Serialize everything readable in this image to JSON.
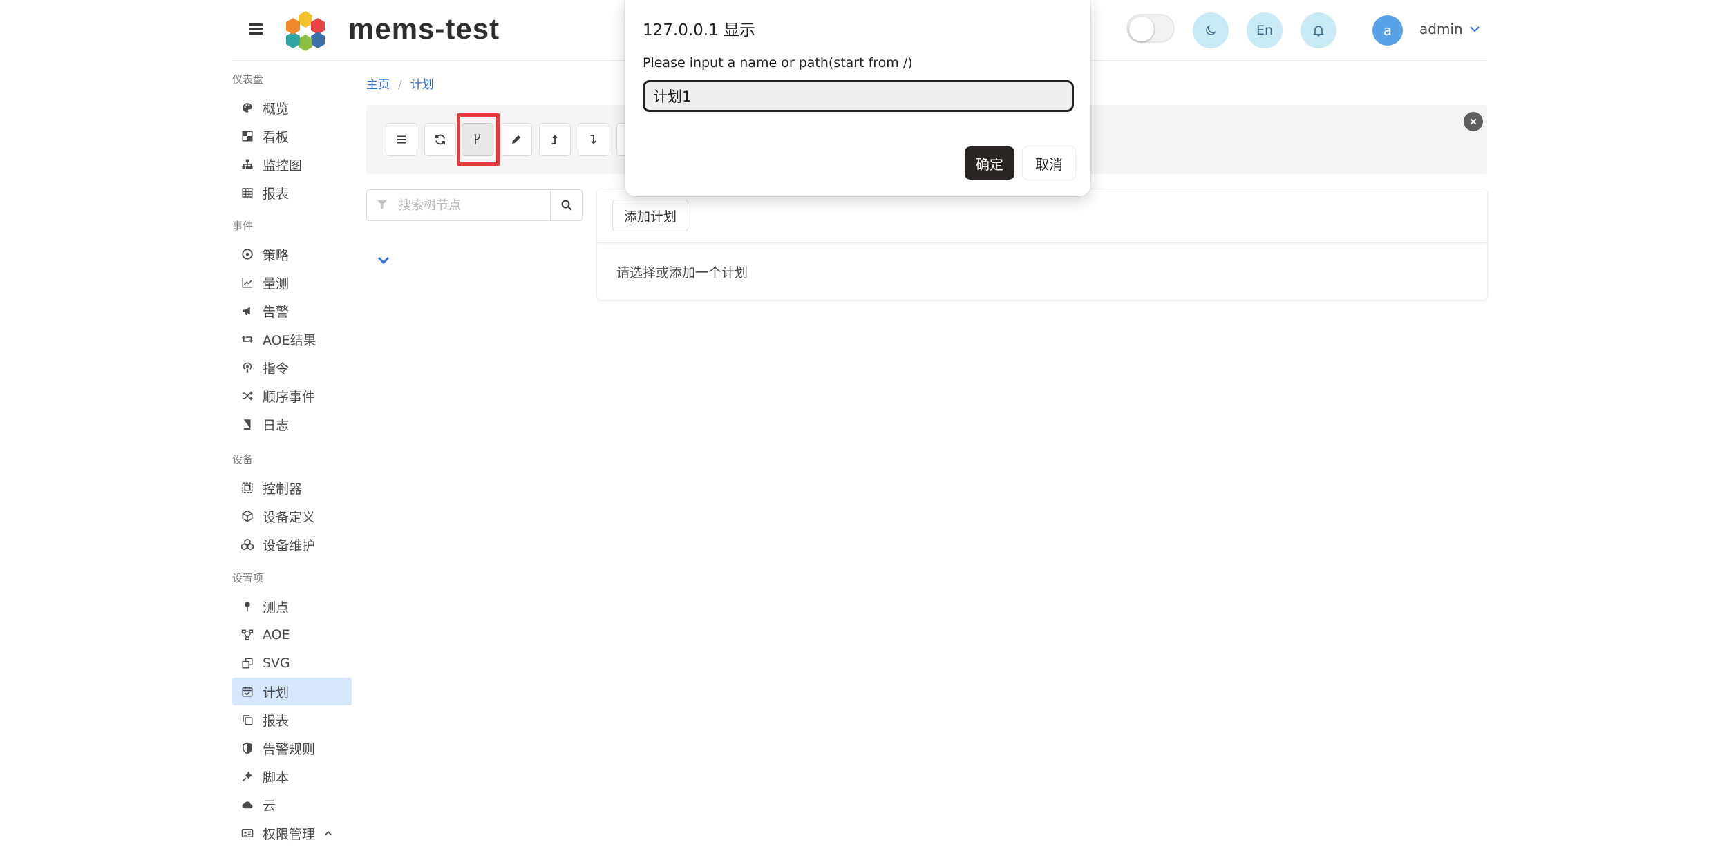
{
  "header": {
    "brand": "mems-test",
    "theme_btn_icon": "moon-icon",
    "lang_label": "En",
    "user_initial": "a",
    "user_name": "admin"
  },
  "sidebar": {
    "sections": [
      {
        "label": "仪表盘",
        "items": [
          {
            "label": "概览",
            "icon": "palette-icon"
          },
          {
            "label": "看板",
            "icon": "board-icon"
          },
          {
            "label": "监控图",
            "icon": "sitemap-icon"
          },
          {
            "label": "报表",
            "icon": "table-icon"
          }
        ]
      },
      {
        "label": "事件",
        "items": [
          {
            "label": "策略",
            "icon": "compass-icon"
          },
          {
            "label": "量测",
            "icon": "chart-line-icon"
          },
          {
            "label": "告警",
            "icon": "bullhorn-icon"
          },
          {
            "label": "AOE结果",
            "icon": "retweet-icon"
          },
          {
            "label": "指令",
            "icon": "podcast-icon"
          },
          {
            "label": "顺序事件",
            "icon": "random-icon"
          },
          {
            "label": "日志",
            "icon": "book-icon"
          }
        ]
      },
      {
        "label": "设备",
        "items": [
          {
            "label": "控制器",
            "icon": "object-group-icon"
          },
          {
            "label": "设备定义",
            "icon": "cube-icon"
          },
          {
            "label": "设备维护",
            "icon": "cubes-icon"
          }
        ]
      },
      {
        "label": "设置项",
        "items": [
          {
            "label": "测点",
            "icon": "thumbtack-icon"
          },
          {
            "label": "AOE",
            "icon": "project-diagram-icon"
          },
          {
            "label": "SVG",
            "icon": "clone-icon"
          },
          {
            "label": "计划",
            "icon": "calendar-check-icon",
            "active": true
          },
          {
            "label": "报表",
            "icon": "copy-icon"
          },
          {
            "label": "告警规则",
            "icon": "shield-icon"
          },
          {
            "label": "脚本",
            "icon": "plug-icon"
          },
          {
            "label": "云",
            "icon": "cloud-icon"
          },
          {
            "label": "权限管理",
            "icon": "id-card-icon"
          }
        ]
      }
    ]
  },
  "breadcrumb": {
    "home": "主页",
    "current": "计划"
  },
  "tree": {
    "search_placeholder": "搜索树节点"
  },
  "plan": {
    "add_label": "添加计划",
    "empty_text": "请选择或添加一个计划"
  },
  "dialog": {
    "title": "127.0.0.1 显示",
    "message": "Please input a name or path(start from /)",
    "value": "计划1",
    "ok_label": "确定",
    "cancel_label": "取消"
  }
}
